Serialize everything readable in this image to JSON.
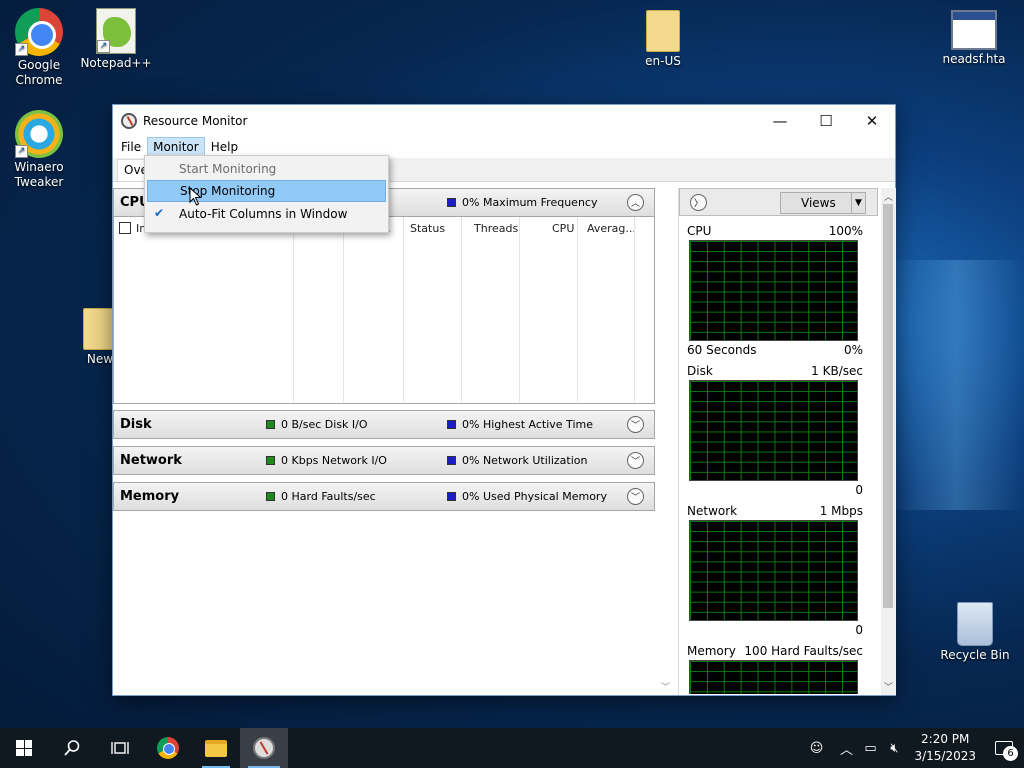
{
  "desktop": {
    "icons": [
      {
        "label": "Google\nChrome"
      },
      {
        "label": "Notepad++"
      },
      {
        "label": "Winaero\nTweaker"
      },
      {
        "label": "New"
      },
      {
        "label": "en-US"
      },
      {
        "label": "neadsf.hta"
      },
      {
        "label": "Recycle Bin"
      }
    ]
  },
  "window": {
    "title": "Resource Monitor",
    "controls": {
      "minimize": "—",
      "maximize": "☐",
      "close": "✕"
    },
    "menus": [
      "File",
      "Monitor",
      "Help"
    ],
    "active_tab_partial": "Over"
  },
  "monitor_menu": {
    "items": [
      {
        "label": "Start Monitoring",
        "state": "disabled"
      },
      {
        "label": "Stop Monitoring",
        "state": "highlighted"
      },
      {
        "label": "Auto-Fit Columns in Window",
        "state": "checked"
      }
    ]
  },
  "sections": {
    "cpu": {
      "name": "CPU",
      "stat2": "0% Maximum Frequency",
      "columns": [
        "Im",
        "...",
        "Status",
        "Threads",
        "CPU",
        "Averag..."
      ]
    },
    "disk": {
      "name": "Disk",
      "stat1": "0 B/sec Disk I/O",
      "stat2": "0% Highest Active Time"
    },
    "network": {
      "name": "Network",
      "stat1": "0 Kbps Network I/O",
      "stat2": "0% Network Utilization"
    },
    "memory": {
      "name": "Memory",
      "stat1": "0 Hard Faults/sec",
      "stat2": "0% Used Physical Memory"
    }
  },
  "right_pane": {
    "views_label": "Views",
    "graphs": [
      {
        "name": "CPU",
        "max": "100%",
        "foot_left": "60 Seconds",
        "foot_right": "0%"
      },
      {
        "name": "Disk",
        "max": "1 KB/sec",
        "foot_left": "",
        "foot_right": "0"
      },
      {
        "name": "Network",
        "max": "1 Mbps",
        "foot_left": "",
        "foot_right": "0"
      },
      {
        "name": "Memory",
        "max": "100 Hard Faults/sec",
        "foot_left": "",
        "foot_right": ""
      }
    ]
  },
  "taskbar": {
    "clock_time": "2:20 PM",
    "clock_date": "3/15/2023",
    "notification_count": "6"
  },
  "colors": {
    "menu_highlight": "#91c9f7",
    "graph_grid": "#0b7a0b",
    "stat_green": "#1e8a1e",
    "stat_blue": "#1b1bc8"
  }
}
